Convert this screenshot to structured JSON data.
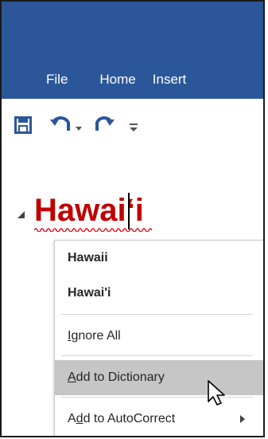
{
  "ribbon": {
    "tabs": [
      "File",
      "Home",
      "Insert"
    ],
    "colors": {
      "bar": "#2b579a",
      "text": "#ffffff"
    }
  },
  "quick_access": {
    "items": [
      "save-icon",
      "undo-icon",
      "undo-dropdown-icon",
      "redo-icon",
      "customize-qat-icon"
    ],
    "colors": {
      "icon": "#2b579a",
      "muted": "#555555"
    }
  },
  "document": {
    "heading": "Hawai‘i",
    "heading_color": "#c00000",
    "spell_error_color": "#e81123"
  },
  "context_menu": {
    "suggestions": [
      "Hawaii",
      "Hawai'i"
    ],
    "ignore_all": {
      "underline": "I",
      "rest": "gnore All"
    },
    "add_to_dictionary": {
      "underline": "A",
      "rest": "dd to Dictionary"
    },
    "add_to_autocorrect": {
      "pre": "A",
      "underline": "d",
      "rest": "d to AutoCorrect"
    },
    "hover_color": "#c6c6c6"
  }
}
